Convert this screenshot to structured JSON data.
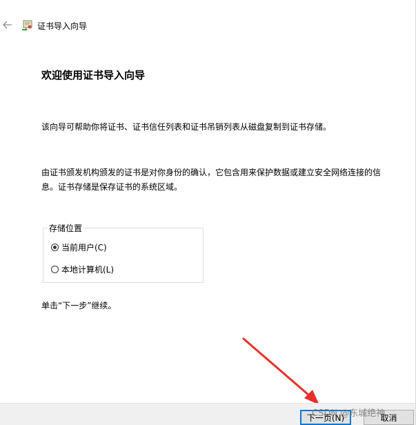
{
  "window": {
    "title": "证书导入向导"
  },
  "icons": {
    "back": "back-arrow-icon",
    "app": "certificate-import-icon"
  },
  "content": {
    "heading": "欢迎使用证书导入向导",
    "paragraph1": "该向导可帮助你将证书、证书信任列表和证书吊销列表从磁盘复制到证书存储。",
    "paragraph2_line1": "由证书颁发机构颁发的证书是对你身份的确认，它包含用来保护数据或建立安全网络连接的信",
    "paragraph2_line2": "息。证书存储是保存证书的系统区域。",
    "store_location": {
      "legend": "存储位置",
      "options": [
        {
          "label": "当前用户(C)",
          "selected": true
        },
        {
          "label": "本地计算机(L)",
          "selected": false
        }
      ]
    },
    "continue_text": "单击“下一步”继续。"
  },
  "footer": {
    "next_label": "下一页(N)",
    "cancel_label": "取消"
  },
  "watermark": "CSDN @东城绝神",
  "colors": {
    "accent": "#0078d7",
    "annotation_arrow": "#e8302a"
  }
}
